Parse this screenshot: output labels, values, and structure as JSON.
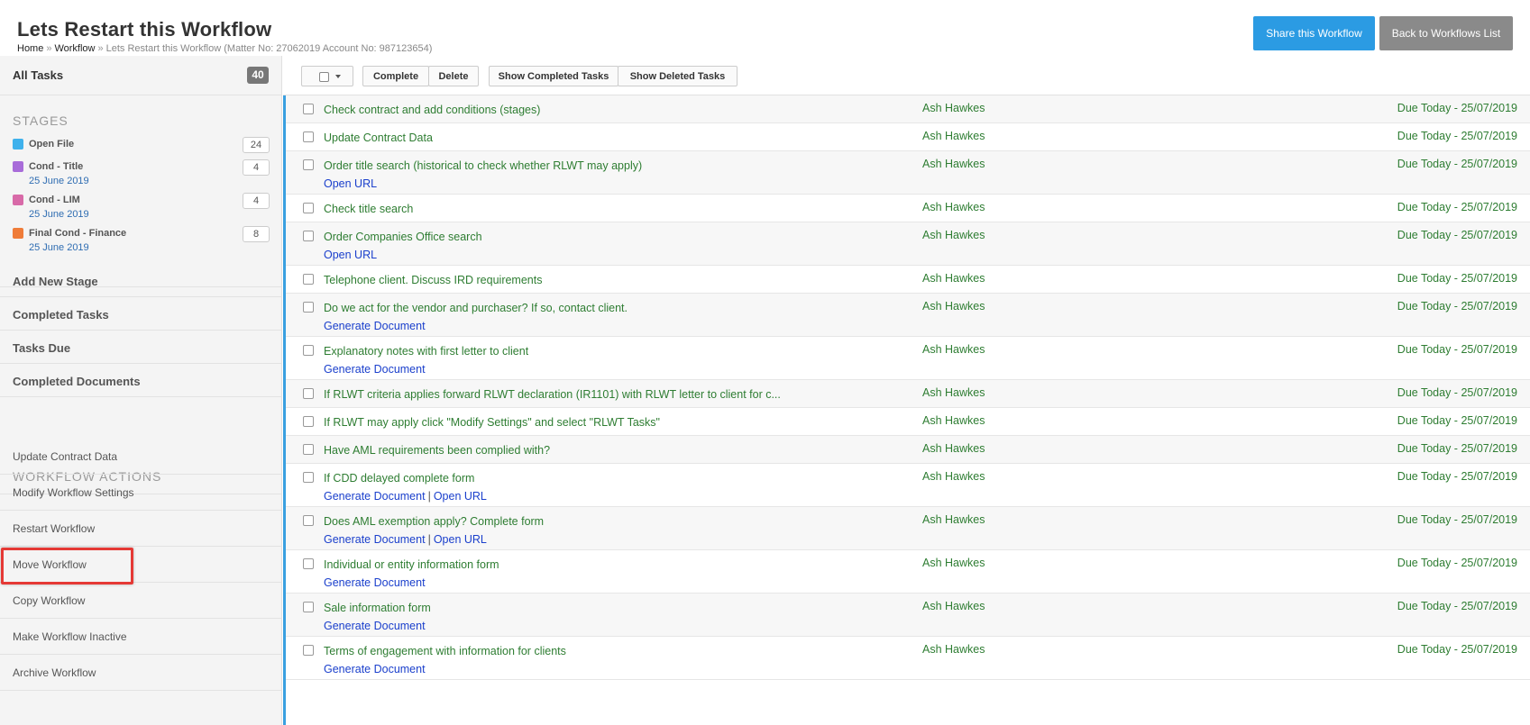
{
  "header": {
    "title": "Lets Restart this Workflow",
    "breadcrumb": {
      "home": "Home",
      "sep": "»",
      "workflow": "Workflow",
      "current": "Lets Restart this Workflow (Matter No: 27062019 Account No: 987123654)"
    },
    "share_label": "Share this Workflow",
    "back_label": "Back to Workflows List"
  },
  "sidebar": {
    "all_tasks_label": "All Tasks",
    "all_tasks_count": "40",
    "stages_heading": "STAGES",
    "stages": [
      {
        "name": "Open File",
        "date": "",
        "count": "24",
        "color": "#3fb1ec"
      },
      {
        "name": "Cond - Title",
        "date": "25 June 2019",
        "count": "4",
        "color": "#a86cd9"
      },
      {
        "name": "Cond - LIM",
        "date": "25 June 2019",
        "count": "4",
        "color": "#d86aa8"
      },
      {
        "name": "Final Cond - Finance",
        "date": "25 June 2019",
        "count": "8",
        "color": "#ef7c39"
      }
    ],
    "nav": [
      {
        "label": "Add New Stage"
      },
      {
        "label": "Completed Tasks"
      },
      {
        "label": "Tasks Due"
      },
      {
        "label": "Completed Documents"
      }
    ],
    "actions_heading": "WORKFLOW ACTIONS",
    "actions": [
      {
        "label": "Update Contract Data"
      },
      {
        "label": "Modify Workflow Settings"
      },
      {
        "label": "Restart Workflow"
      },
      {
        "label": "Move Workflow"
      },
      {
        "label": "Copy Workflow"
      },
      {
        "label": "Make Workflow Inactive"
      },
      {
        "label": "Archive Workflow"
      }
    ]
  },
  "toolbar": {
    "complete_label": "Complete",
    "delete_label": "Delete",
    "show_completed_label": "Show Completed Tasks",
    "show_deleted_label": "Show Deleted Tasks"
  },
  "link_separator": "|",
  "tasks": [
    {
      "title": "Check contract and add conditions (stages)",
      "links": [],
      "assignee": "Ash Hawkes",
      "due": "Due Today - 25/07/2019"
    },
    {
      "title": "Update Contract Data",
      "links": [],
      "assignee": "Ash Hawkes",
      "due": "Due Today - 25/07/2019"
    },
    {
      "title": "Order title search (historical to check whether RLWT may apply)",
      "links": [
        "Open URL"
      ],
      "assignee": "Ash Hawkes",
      "due": "Due Today - 25/07/2019"
    },
    {
      "title": "Check title search",
      "links": [],
      "assignee": "Ash Hawkes",
      "due": "Due Today - 25/07/2019"
    },
    {
      "title": "Order Companies Office search",
      "links": [
        "Open URL"
      ],
      "assignee": "Ash Hawkes",
      "due": "Due Today - 25/07/2019"
    },
    {
      "title": "Telephone client. Discuss IRD requirements",
      "links": [],
      "assignee": "Ash Hawkes",
      "due": "Due Today - 25/07/2019"
    },
    {
      "title": "Do we act for the vendor and purchaser? If so, contact client.",
      "links": [
        "Generate Document"
      ],
      "assignee": "Ash Hawkes",
      "due": "Due Today - 25/07/2019"
    },
    {
      "title": "Explanatory notes with first letter to client",
      "links": [
        "Generate Document"
      ],
      "assignee": "Ash Hawkes",
      "due": "Due Today - 25/07/2019"
    },
    {
      "title": "If RLWT criteria applies forward RLWT declaration (IR1101) with RLWT letter to client for c...",
      "links": [],
      "assignee": "Ash Hawkes",
      "due": "Due Today - 25/07/2019"
    },
    {
      "title": "If RLWT may apply click \"Modify Settings\" and select \"RLWT Tasks\"",
      "links": [],
      "assignee": "Ash Hawkes",
      "due": "Due Today - 25/07/2019"
    },
    {
      "title": "Have AML requirements been complied with?",
      "links": [],
      "assignee": "Ash Hawkes",
      "due": "Due Today - 25/07/2019"
    },
    {
      "title": "If CDD delayed complete form",
      "links": [
        "Generate Document",
        "Open URL"
      ],
      "assignee": "Ash Hawkes",
      "due": "Due Today - 25/07/2019"
    },
    {
      "title": "Does AML exemption apply? Complete form",
      "links": [
        "Generate Document",
        "Open URL"
      ],
      "assignee": "Ash Hawkes",
      "due": "Due Today - 25/07/2019"
    },
    {
      "title": "Individual or entity information form",
      "links": [
        "Generate Document"
      ],
      "assignee": "Ash Hawkes",
      "due": "Due Today - 25/07/2019"
    },
    {
      "title": "Sale information form",
      "links": [
        "Generate Document"
      ],
      "assignee": "Ash Hawkes",
      "due": "Due Today - 25/07/2019"
    },
    {
      "title": "Terms of engagement with information for clients",
      "links": [
        "Generate Document"
      ],
      "assignee": "Ash Hawkes",
      "due": "Due Today - 25/07/2019"
    }
  ]
}
